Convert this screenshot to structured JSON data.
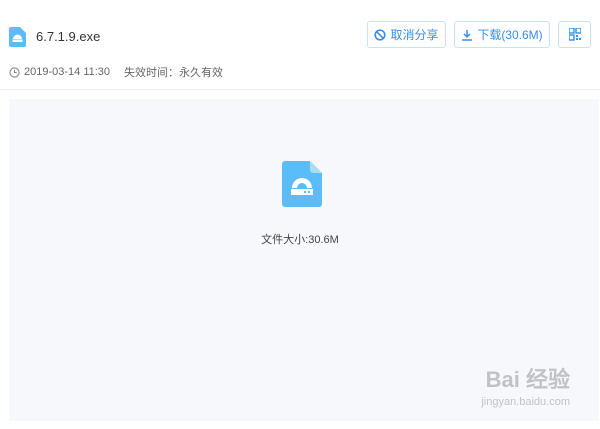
{
  "file": {
    "name": "6.7.1.9.exe",
    "date": "2019-03-14 11:30",
    "expiry": "失效时间：永久有效",
    "size_label": "文件大小:30.6M"
  },
  "buttons": {
    "cancel_share": "取消分享",
    "download": "下载(30.6M)"
  },
  "watermark": {
    "brand": "Bai 经验",
    "url": "jingyan.baidu.com"
  },
  "colors": {
    "accent": "#3a8ee6",
    "file_icon": "#5bbcf7"
  }
}
